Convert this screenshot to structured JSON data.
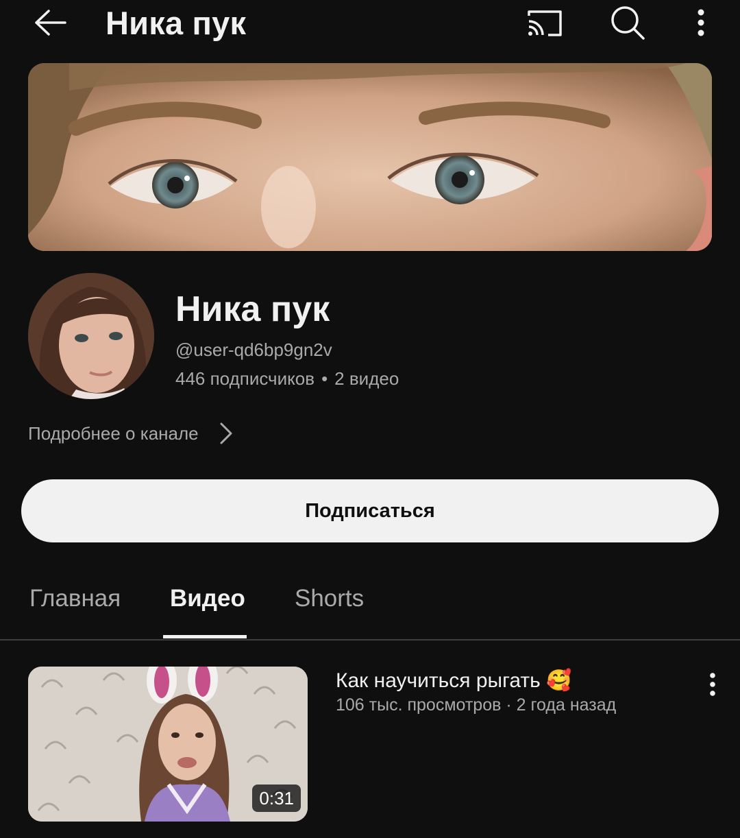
{
  "topbar": {
    "title": "Ника пук",
    "icons": [
      "back-arrow-icon",
      "cast-icon",
      "search-icon",
      "more-vert-icon"
    ]
  },
  "channel": {
    "name": "Ника пук",
    "handle": "@user-qd6bp9gn2v",
    "subscribers": "446 подписчиков",
    "separator": "•",
    "videos": "2 видео",
    "about_label": "Подробнее о канале",
    "subscribe_label": "Подписаться"
  },
  "tabs": [
    {
      "label": "Главная",
      "active": false
    },
    {
      "label": "Видео",
      "active": true
    },
    {
      "label": "Shorts",
      "active": false
    }
  ],
  "videos": [
    {
      "title": "Как научиться рыгать 🥰",
      "meta": "106 тыс. просмотров · 2 года назад",
      "duration": "0:31"
    }
  ],
  "colors": {
    "background": "#0f0f0f",
    "text_primary": "#f1f1f1",
    "text_secondary": "#aaaaaa",
    "button_bg": "#f1f1f1"
  }
}
